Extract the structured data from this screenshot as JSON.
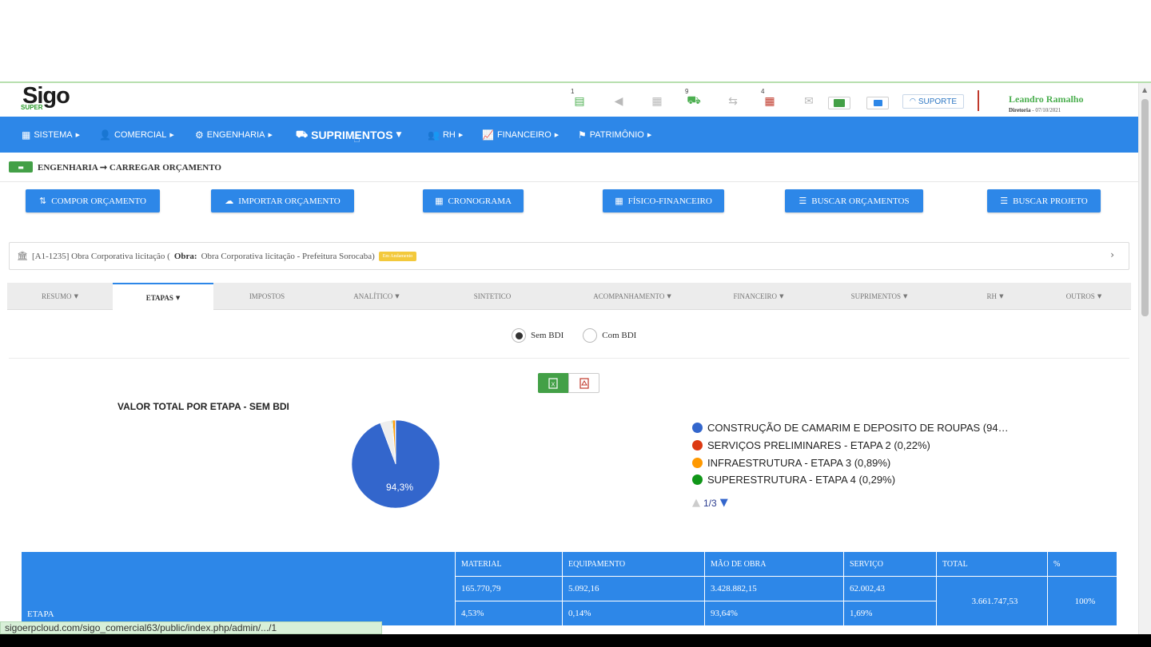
{
  "header": {
    "logo_text": "Sigo",
    "logo_sub": "SUPER",
    "icons": [
      {
        "name": "tasks-icon",
        "count": "1",
        "glyph": "▤"
      },
      {
        "name": "megaphone-icon",
        "count": "",
        "glyph": "◀"
      },
      {
        "name": "calendar-icon",
        "count": "",
        "glyph": "▦"
      },
      {
        "name": "truck-icon",
        "count": "9",
        "glyph": "⛟"
      },
      {
        "name": "transfer-icon",
        "count": "",
        "glyph": "⇆"
      },
      {
        "name": "table-icon",
        "count": "4",
        "glyph": "▦"
      },
      {
        "name": "mail-icon",
        "count": "",
        "glyph": "✉"
      }
    ],
    "support_label": "SUPORTE",
    "user_name": "Leandro Ramalho",
    "user_role": "Diretoria",
    "user_date": "- 07/10/2021"
  },
  "nav": {
    "items": [
      {
        "label": "SISTEMA",
        "icon": "▦"
      },
      {
        "label": "COMERCIAL",
        "icon": "👤"
      },
      {
        "label": "ENGENHARIA",
        "icon": "⚙"
      },
      {
        "label": "SUPRIMENTOS",
        "icon": "⛟"
      },
      {
        "label": "RH",
        "icon": "👥"
      },
      {
        "label": "FINANCEIRO",
        "icon": "📈"
      },
      {
        "label": "PATRIMÔNIO",
        "icon": "⚑"
      }
    ]
  },
  "breadcrumb": {
    "text": "ENGENHARIA ➞ CARREGAR ORÇAMENTO"
  },
  "actions": [
    {
      "label": "COMPOR ORÇAMENTO",
      "icon": "⇅"
    },
    {
      "label": "IMPORTAR ORÇAMENTO",
      "icon": "☁"
    },
    {
      "label": "CRONOGRAMA",
      "icon": "▦"
    },
    {
      "label": "FÍSICO-FINANCEIRO",
      "icon": "▦"
    },
    {
      "label": "BUSCAR ORÇAMENTOS",
      "icon": "☰"
    },
    {
      "label": "BUSCAR PROJETO",
      "icon": "☰"
    }
  ],
  "obra": {
    "code": "[A1-1235] Obra Corporativa licitação (",
    "label": "Obra:",
    "value": "Obra Corporativa licitação - Prefeitura Sorocaba)",
    "badge": "Em Andamento"
  },
  "tabs": [
    {
      "label": "RESUMO",
      "caret": true
    },
    {
      "label": "ETAPAS",
      "caret": true
    },
    {
      "label": "IMPOSTOS",
      "caret": false
    },
    {
      "label": "ANALÍTICO",
      "caret": true
    },
    {
      "label": "SINTETICO",
      "caret": false
    },
    {
      "label": "ACOMPANHAMENTO",
      "caret": true
    },
    {
      "label": "FINANCEIRO",
      "caret": true
    },
    {
      "label": "SUPRIMENTOS",
      "caret": true
    },
    {
      "label": "RH",
      "caret": true
    },
    {
      "label": "OUTROS",
      "caret": true
    }
  ],
  "bdi": {
    "option1": "Sem BDI",
    "option2": "Com BDI",
    "selected": "Sem BDI"
  },
  "chart_data": {
    "type": "pie",
    "title": "VALOR TOTAL POR ETAPA - SEM BDI",
    "slices": [
      {
        "label": "CONSTRUÇÃO DE CAMARIM E DEPOSITO DE ROUPAS (94…",
        "value": 94.3,
        "color": "#3366cc"
      },
      {
        "label": "SERVIÇOS PRELIMINARES - ETAPA 2 (0,22%)",
        "value": 0.22,
        "color": "#dc3912"
      },
      {
        "label": "INFRAESTRUTURA - ETAPA 3 (0,89%)",
        "value": 0.89,
        "color": "#ff9900"
      },
      {
        "label": "SUPERESTRUTURA - ETAPA 4 (0,29%)",
        "value": 0.29,
        "color": "#109618"
      },
      {
        "label": "",
        "value": 4.3,
        "color": "#eeeeee"
      }
    ],
    "slice_label": "94,3%",
    "legend_position": "right",
    "pager": "1/3"
  },
  "table": {
    "headers": [
      "ETAPA",
      "MATERIAL",
      "EQUIPAMENTO",
      "MÃO DE OBRA",
      "SERVIÇO",
      "TOTAL",
      "%"
    ],
    "values_row": [
      "165.770,79",
      "5.092,16",
      "3.428.882,15",
      "62.002,43"
    ],
    "percent_row": [
      "4,53%",
      "0,14%",
      "93,64%",
      "1,69%"
    ],
    "total": "3.661.747,53",
    "total_pct": "100%"
  },
  "statusbar": {
    "url": "sigoerpcloud.com/sigo_comercial63/public/index.php/admin/.../1"
  }
}
